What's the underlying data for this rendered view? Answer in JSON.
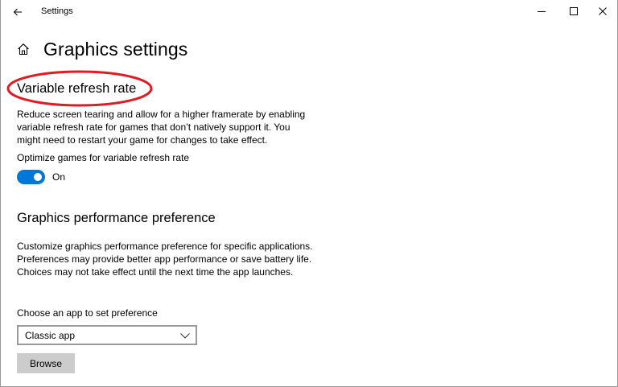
{
  "window": {
    "title": "Settings",
    "back_icon": "arrow-left-icon",
    "controls": [
      "minimize-icon",
      "maximize-icon",
      "close-icon"
    ]
  },
  "header": {
    "home_icon": "home-icon",
    "title": "Graphics settings"
  },
  "variable_refresh_rate": {
    "title": "Variable refresh rate",
    "description": "Reduce screen tearing and allow for a higher framerate by enabling variable refresh rate for games that don’t natively support it. You might need to restart your game for changes to take effect.",
    "toggle_label": "Optimize games for variable refresh rate",
    "toggle_on": true,
    "toggle_state_text": "On",
    "annotation_color": "#e01b24"
  },
  "graphics_performance": {
    "title": "Graphics performance preference",
    "description": "Customize graphics performance preference for specific applications. Preferences may provide better app performance or save battery life. Choices may not take effect until the next time the app launches.",
    "choose_label": "Choose an app to set preference",
    "dropdown_value": "Classic app",
    "browse_label": "Browse"
  },
  "colors": {
    "accent": "#0078d7",
    "button_bg": "#cccccc",
    "border": "#9a9a9a"
  }
}
